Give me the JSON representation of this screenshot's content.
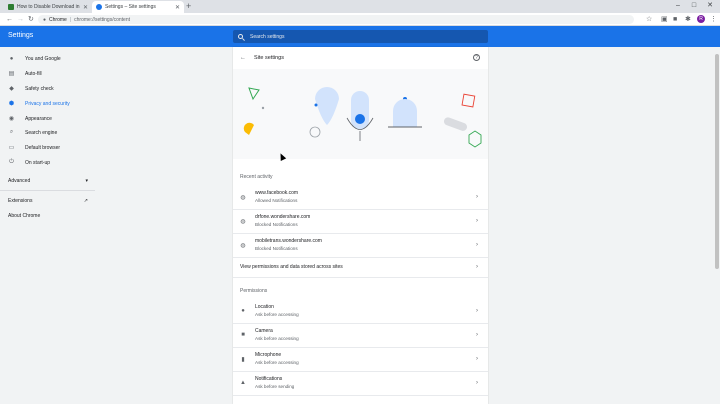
{
  "browser": {
    "tabs": [
      {
        "title": "How to Disable Download in Chr",
        "active": false,
        "favicon_color": "#2e7d32"
      },
      {
        "title": "Settings – Site settings",
        "active": true,
        "favicon_color": "#1a73e8"
      }
    ],
    "new_tab_label": "+",
    "window_controls": [
      "–",
      "□",
      "✕"
    ],
    "omnibox": {
      "site": "Chrome",
      "separator": "|",
      "url": "chrome://settings/content"
    },
    "avatar_letter": "R"
  },
  "header": {
    "title": "Settings",
    "search_placeholder": "Search settings"
  },
  "sidebar": {
    "items": [
      {
        "label": "You and Google",
        "icon": "person-icon"
      },
      {
        "label": "Auto-fill",
        "icon": "list-icon"
      },
      {
        "label": "Safety check",
        "icon": "shield-check-icon"
      },
      {
        "label": "Privacy and security",
        "icon": "shield-icon",
        "active": true
      },
      {
        "label": "Appearance",
        "icon": "palette-icon"
      },
      {
        "label": "Search engine",
        "icon": "search-icon"
      },
      {
        "label": "Default browser",
        "icon": "browser-icon"
      },
      {
        "label": "On start-up",
        "icon": "power-icon"
      }
    ],
    "advanced": "Advanced",
    "extensions": "Extensions",
    "about": "About Chrome"
  },
  "page": {
    "title": "Site settings",
    "recent_activity_label": "Recent activity",
    "recent": [
      {
        "site": "www.facebook.com",
        "status": "Allowed Notifications"
      },
      {
        "site": "drfone.wondershare.com",
        "status": "Blocked Notifications"
      },
      {
        "site": "mobiletrans.wondershare.com",
        "status": "Blocked Notifications"
      }
    ],
    "view_all": "View permissions and data stored across sites",
    "permissions_label": "Permissions",
    "permissions": [
      {
        "name": "Location",
        "status": "Ask before accessing",
        "icon": "location-icon"
      },
      {
        "name": "Camera",
        "status": "Ask before accessing",
        "icon": "camera-icon"
      },
      {
        "name": "Microphone",
        "status": "Ask before accessing",
        "icon": "microphone-icon"
      },
      {
        "name": "Notifications",
        "status": "Ask before sending",
        "icon": "bell-icon"
      }
    ]
  },
  "colors": {
    "accent": "#1a73e8",
    "header": "#1a73e8"
  }
}
